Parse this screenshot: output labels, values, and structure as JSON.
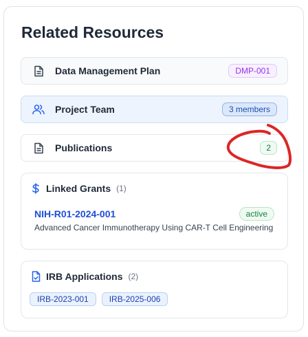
{
  "title": "Related Resources",
  "resources": [
    {
      "label": "Data Management Plan",
      "badge": "DMP-001",
      "icon": "document-icon"
    },
    {
      "label": "Project Team",
      "badge": "3 members",
      "icon": "users-icon"
    },
    {
      "label": "Publications",
      "badge": "2",
      "icon": "document-icon"
    }
  ],
  "grants": {
    "title": "Linked Grants",
    "count": "(1)",
    "icon": "dollar-icon",
    "items": [
      {
        "id": "NIH-R01-2024-001",
        "status": "active",
        "description": "Advanced Cancer Immunotherapy Using CAR-T Cell Engineering"
      }
    ]
  },
  "irb": {
    "title": "IRB Applications",
    "count": "(2)",
    "icon": "file-check-icon",
    "items": [
      "IRB-2023-001",
      "IRB-2025-006"
    ]
  },
  "colors": {
    "accent": "#1d4ed8",
    "annotation": "#dc2626",
    "success": "#15803d",
    "purple": "#9333ea"
  }
}
